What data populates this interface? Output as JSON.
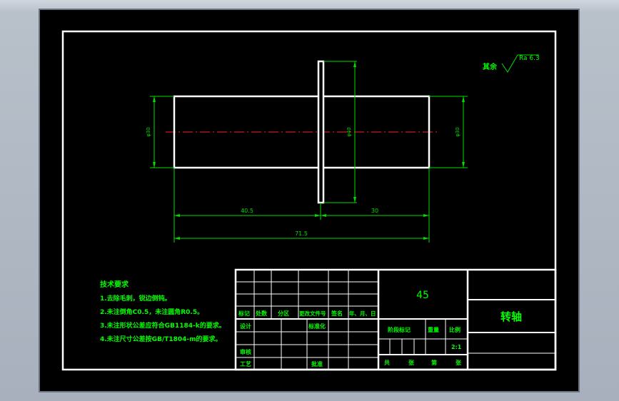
{
  "surface_finish": {
    "prefix": "其余",
    "value": "Ra 6.3"
  },
  "dimensions": {
    "left_diameter": "φ30",
    "right_diameter": "φ30",
    "flange_diameter": "φ40",
    "length_left": "40.5",
    "length_right": "30",
    "length_total": "71.5"
  },
  "tech_requirements": {
    "title": "技术要求",
    "items": [
      "1.去除毛刺，锐边倒钝。",
      "2.未注倒角C0.5，未注圆角R0.5。",
      "3.未注形状公差应符合GB1184-k的要求。",
      "4.未注尺寸公差按GB/T1804-m的要求。"
    ]
  },
  "title_block": {
    "material": "45",
    "part_name": "转轴",
    "header_labels": [
      "标记",
      "处数",
      "分区",
      "更改文件号",
      "签名",
      "年、月、日"
    ],
    "design": "设计",
    "standardize": "标准化",
    "check": "审核",
    "process": "工艺",
    "approve": "批准",
    "stage_label": "阶段标记",
    "weight_label": "重量",
    "scale_label": "比例",
    "scale_value": "2:1",
    "total": "共",
    "sheets": "张",
    "sheet_no": "第",
    "sheet": "张"
  },
  "colors": {
    "background": "#000000",
    "outline": "#ffffff",
    "dimension": "#00ff00",
    "centerline": "#ff0000",
    "text": "#00ff00"
  }
}
